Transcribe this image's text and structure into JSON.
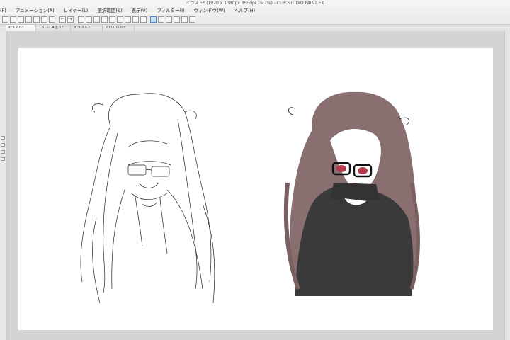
{
  "window": {
    "title": "イラスト* (1920 x 1080px 350dpi 76.7%) - CLIP STUDIO PAINT EX"
  },
  "menu": {
    "items": [
      "(F)",
      "アニメーション(A)",
      "レイヤー(L)",
      "選択範囲(S)",
      "表示(V)",
      "フィルター(I)",
      "ウィンドウ(W)",
      "ヘルプ(H)"
    ]
  },
  "tabs": [
    {
      "label": "イラスト*",
      "active": true
    },
    {
      "label": "S1 -1.4倍カ*"
    },
    {
      "label": "イラスト2"
    },
    {
      "label": "20210320*"
    }
  ],
  "canvas": {
    "left_figure": "lineart-figure",
    "right_figure": "colored-figure",
    "colors": {
      "hair": "#8a6f70",
      "sweater": "#3a3a3a",
      "skin": "#ffffff",
      "eyes": "#b23a4a",
      "line": "#222222"
    }
  },
  "toolbar_icons": [
    "new-icon",
    "open-icon",
    "save-icon",
    "undo-icon",
    "redo-icon",
    "clear-icon",
    "fill-icon",
    "transform-icon",
    "crop-icon",
    "snap-icon",
    "ruler-icon",
    "grid-icon",
    "guide-icon",
    "symmetry-icon",
    "perspective-icon"
  ]
}
